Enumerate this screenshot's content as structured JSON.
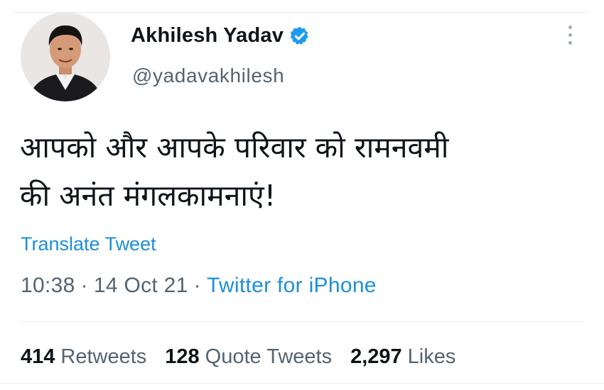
{
  "author": {
    "display_name": "Akhilesh Yadav",
    "handle": "@yadavakhilesh",
    "verified": true,
    "avatar_icon": "profile-photo"
  },
  "tweet": {
    "text": "आपको और आपके परिवार को रामनवमी\nकी अनंत मंगलकामनाएं!",
    "translate_label": "Translate Tweet",
    "time": "10:38",
    "date": "14 Oct 21",
    "separator": "·",
    "source": "Twitter for iPhone"
  },
  "stats": {
    "retweets_count": "414",
    "retweets_label": "Retweets",
    "quote_tweets_count": "128",
    "quote_tweets_label": "Quote Tweets",
    "likes_count": "2,297",
    "likes_label": "Likes"
  },
  "colors": {
    "link": "#1d8fd8",
    "secondary_text": "#536471",
    "primary_text": "#0f1419",
    "verified_badge": "#1d9bf0"
  }
}
